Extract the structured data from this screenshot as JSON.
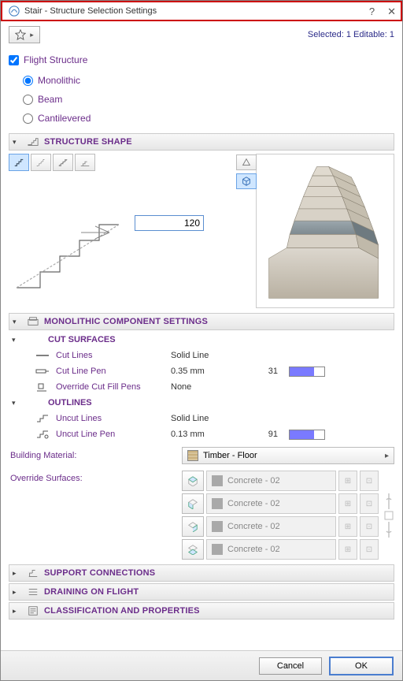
{
  "window": {
    "title": "Stair - Structure Selection Settings"
  },
  "header": {
    "selection_text": "Selected: 1 Editable: 1"
  },
  "flight": {
    "checkbox_label": "Flight Structure",
    "checked": true,
    "options": [
      {
        "label": "Monolithic",
        "checked": true
      },
      {
        "label": "Beam",
        "checked": false
      },
      {
        "label": "Cantilevered",
        "checked": false
      }
    ]
  },
  "sections": {
    "structure_shape": {
      "title": "STRUCTURE SHAPE",
      "dimension_value": "120"
    },
    "monolithic": {
      "title": "MONOLITHIC COMPONENT SETTINGS",
      "cut_surfaces": {
        "title": "CUT SURFACES",
        "rows": [
          {
            "name": "Cut Lines",
            "value": "Solid Line",
            "index": "",
            "swatch": false
          },
          {
            "name": "Cut Line Pen",
            "value": "0.35 mm",
            "index": "31",
            "swatch": true
          },
          {
            "name": "Override Cut Fill Pens",
            "value": "None",
            "index": "",
            "swatch": false
          }
        ]
      },
      "outlines": {
        "title": "OUTLINES",
        "rows": [
          {
            "name": "Uncut Lines",
            "value": "Solid Line",
            "index": "",
            "swatch": false
          },
          {
            "name": "Uncut Line Pen",
            "value": "0.13 mm",
            "index": "91",
            "swatch": true
          }
        ]
      }
    },
    "support": {
      "title": "SUPPORT CONNECTIONS"
    },
    "draining": {
      "title": "DRAINING ON FLIGHT"
    },
    "classification": {
      "title": "CLASSIFICATION AND PROPERTIES"
    }
  },
  "building_material": {
    "label": "Building Material:",
    "value": "Timber - Floor"
  },
  "override_surfaces": {
    "label": "Override Surfaces:",
    "rows": [
      {
        "value": "Concrete - 02"
      },
      {
        "value": "Concrete - 02"
      },
      {
        "value": "Concrete - 02"
      },
      {
        "value": "Concrete - 02"
      }
    ]
  },
  "footer": {
    "cancel": "Cancel",
    "ok": "OK"
  },
  "icons": {
    "star": "star-icon",
    "help": "help-icon",
    "close": "close-icon",
    "stair_modes": [
      "stair-profile-1",
      "stair-profile-2",
      "stair-profile-3",
      "stair-profile-4"
    ],
    "preview_toggle": "cube-toggle-icon",
    "perspective": "perspective-icon"
  }
}
